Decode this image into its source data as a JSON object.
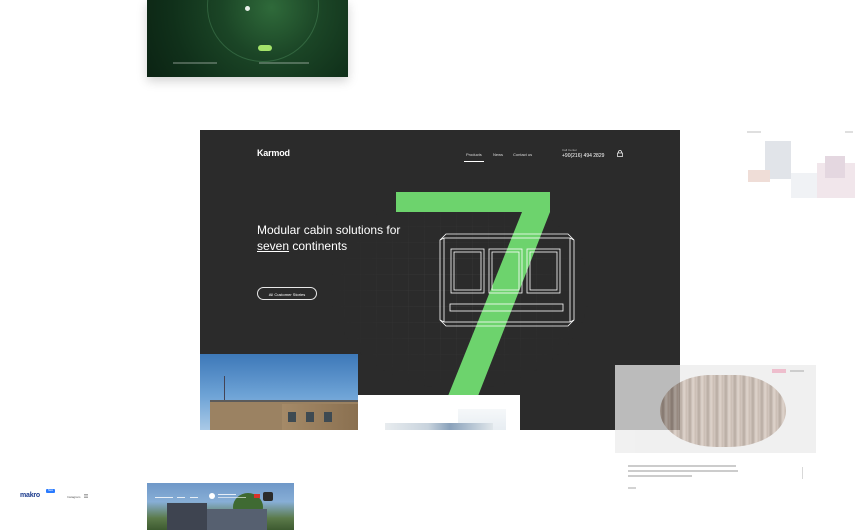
{
  "main": {
    "brand": "Karmod",
    "nav": {
      "products": "Products",
      "news": "News",
      "contact": "Contact us"
    },
    "callcenter_label": "Call Center",
    "phone": "+90(216) 494 2829",
    "headline_part1": "Modular cabin solutions for",
    "headline_link": "seven",
    "headline_part2": "continents",
    "cta": "All Customer Stories",
    "accent_color": "#6dd36d",
    "background_color": "#2b2b2b"
  },
  "makro": {
    "logo": "makro",
    "badge": "New",
    "link": "Instagram"
  },
  "icons": {
    "lock": "lock-icon",
    "menu": "menu-icon",
    "phone": "phone-icon"
  }
}
